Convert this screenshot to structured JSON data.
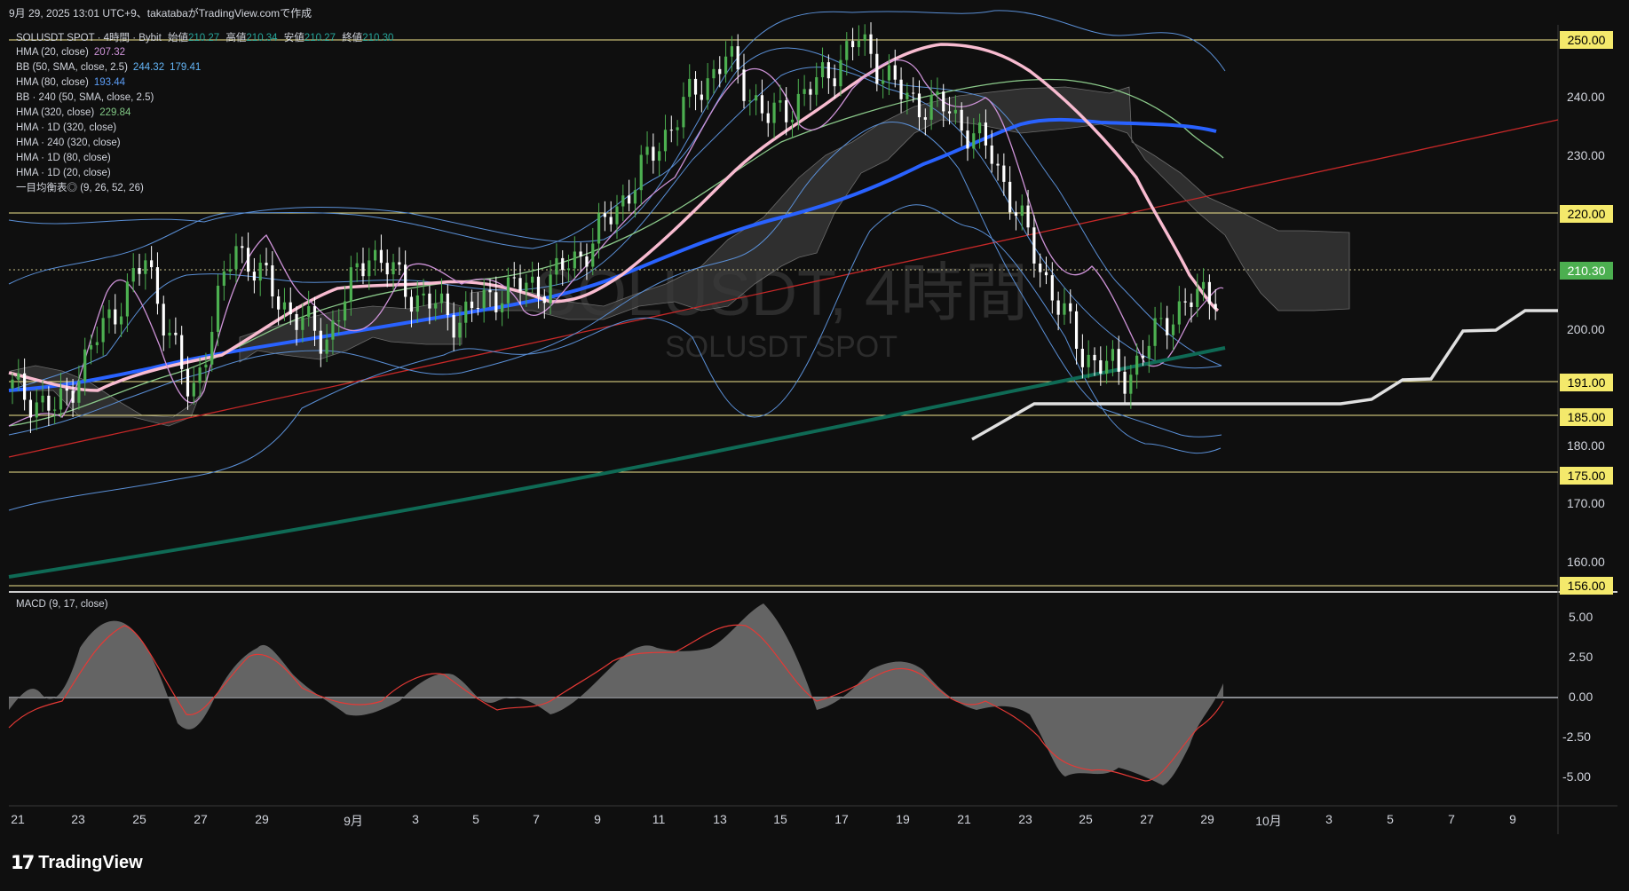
{
  "header": "9月 29, 2025 13:01 UTC+9、takatabaがTradingView.comで作成",
  "footer_brand": "TradingView",
  "watermark": {
    "symbol": "SOLUSDT, 4時間",
    "sub": "SOLUSDT SPOT"
  },
  "ohlc": {
    "symbol": "SOLUSDT SPOT · 4時間 · Bybit",
    "open_label": "始値",
    "open": "210.27",
    "high_label": "高値",
    "high": "210.34",
    "low_label": "安値",
    "low": "210.27",
    "close_label": "終値",
    "close": "210.30"
  },
  "legend": [
    {
      "label": "HMA (20, close)",
      "value": "207.32",
      "color": "#ce93d8"
    },
    {
      "label": "BB (50, SMA, close, 2.5)",
      "value": "244.32",
      "value2": "179.41",
      "color": "#64b5f6"
    },
    {
      "label": "HMA (80, close)",
      "value": "193.44",
      "color": "#5b9cf5"
    },
    {
      "label": "BB · 240 (50, SMA, close, 2.5)",
      "value": "",
      "color": "#d1d4dc"
    },
    {
      "label": "HMA (320, close)",
      "value": "229.84",
      "color": "#81c784"
    },
    {
      "label": "HMA · 1D (320, close)",
      "value": "",
      "color": "#d1d4dc"
    },
    {
      "label": "HMA · 240 (320, close)",
      "value": "",
      "color": "#d1d4dc"
    },
    {
      "label": "HMA · 1D (80, close)",
      "value": "",
      "color": "#d1d4dc"
    },
    {
      "label": "HMA · 1D (20, close)",
      "value": "",
      "color": "#d1d4dc"
    },
    {
      "label": "一目均衡表◎ (9, 26, 52, 26)",
      "value": "",
      "color": "#d1d4dc"
    }
  ],
  "macd_title": "MACD (9, 17, close)",
  "colors": {
    "up": "#4caf50",
    "down": "#ffffff",
    "pink": "#f8bbd0",
    "blue": "#2962ff",
    "teal": "#00695c",
    "level": "#f0e68c"
  },
  "chart_data": [
    {
      "type": "line",
      "title": "SOLUSDT, 4時間",
      "ylim": [
        150,
        255
      ],
      "y_ticks": [
        "240.00",
        "230.00",
        "200.00",
        "180.00",
        "170.00",
        "160.00"
      ],
      "x_ticks": [
        "21",
        "23",
        "25",
        "27",
        "29",
        "9月",
        "3",
        "5",
        "7",
        "9",
        "11",
        "13",
        "15",
        "17",
        "19",
        "21",
        "23",
        "25",
        "27",
        "29",
        "10月",
        "3",
        "5",
        "7",
        "9"
      ],
      "horizontal_levels": [
        "250.00",
        "220.00",
        "191.00",
        "185.00",
        "175.00",
        "156.00"
      ],
      "last_price": "210.30",
      "series": [
        {
          "name": "HMA (20, close)",
          "values": [
            190,
            186,
            200,
            212,
            188,
            215,
            205,
            198,
            214,
            206,
            202,
            207,
            208,
            215,
            226,
            238,
            247,
            236,
            242,
            250,
            240,
            238,
            230,
            212,
            196,
            192,
            203,
            207
          ]
        },
        {
          "name": "HMA (80, close)",
          "values": [
            194,
            190,
            194,
            200,
            201,
            208,
            209,
            206,
            207,
            205,
            206,
            216,
            228,
            240,
            245,
            242,
            244,
            242,
            236,
            226,
            212,
            200,
            194,
            193
          ]
        },
        {
          "name": "HMA (320, close)",
          "values": [
            184,
            186,
            193,
            198,
            202,
            204,
            205,
            206,
            210,
            218,
            225,
            231,
            234,
            238,
            242,
            243,
            240,
            236,
            230
          ]
        }
      ]
    },
    {
      "type": "area",
      "title": "MACD (9, 17, close)",
      "ylim": [
        -6,
        6.5
      ],
      "y_ticks": [
        "5.00",
        "2.50",
        "0.00",
        "-2.50",
        "-5.00"
      ],
      "series": [
        {
          "name": "MACD",
          "values": [
            -1,
            0.5,
            -0.3,
            3,
            4.6,
            3.5,
            -1.2,
            -1,
            0.5,
            2.8,
            3.1,
            0.8,
            -0.3,
            -0.8,
            -0.4,
            1.6,
            1.1,
            -0.2,
            -0.6,
            -0.4,
            0.2,
            2.4,
            2.9,
            3,
            4.6,
            5.3,
            3.5,
            1.6,
            0,
            -0.2,
            1.4,
            2.3,
            0.1,
            -0.3,
            -2.6,
            -4.3,
            -4.8,
            -3.4,
            -5.5,
            -4.5,
            -2,
            -1.2,
            1.2
          ]
        }
      ]
    }
  ]
}
